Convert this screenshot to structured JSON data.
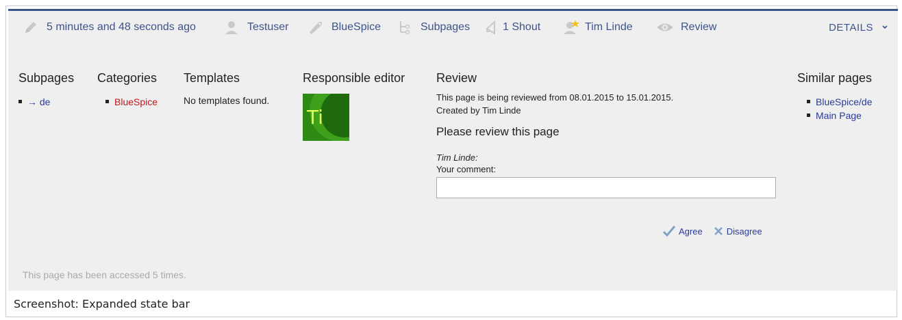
{
  "bar": {
    "edited": "5 minutes and 48 seconds ago",
    "user": "Testuser",
    "category": "BlueSpice",
    "subpages": "Subpages",
    "shouts": "1 Shout",
    "editor": "Tim Linde",
    "review": "Review",
    "details": "DETAILS"
  },
  "subpages": {
    "title": "Subpages",
    "items": [
      "→ de"
    ]
  },
  "categories": {
    "title": "Categories",
    "items": [
      "BlueSpice"
    ]
  },
  "templates": {
    "title": "Templates",
    "empty": "No templates found."
  },
  "responsible": {
    "title": "Responsible editor",
    "initials": "Ti"
  },
  "review": {
    "title": "Review",
    "line1": "This page is being reviewed from 08.01.2015 to 15.01.2015.",
    "line2": "Created by Tim Linde",
    "heading": "Please review this page",
    "reviewer": "Tim Linde:",
    "comment_label": "Your comment:",
    "comment_value": "",
    "agree": "Agree",
    "disagree": "Disagree"
  },
  "similar": {
    "title": "Similar pages",
    "items": [
      "BlueSpice/de",
      "Main Page"
    ]
  },
  "footer": {
    "accessed": "This page has been accessed 5 times."
  },
  "caption": "Screenshot: Expanded state bar",
  "colors": {
    "accent": "#3e538a",
    "link": "#2a3a9a",
    "red_link": "#c2161e",
    "panel": "#efefef"
  }
}
